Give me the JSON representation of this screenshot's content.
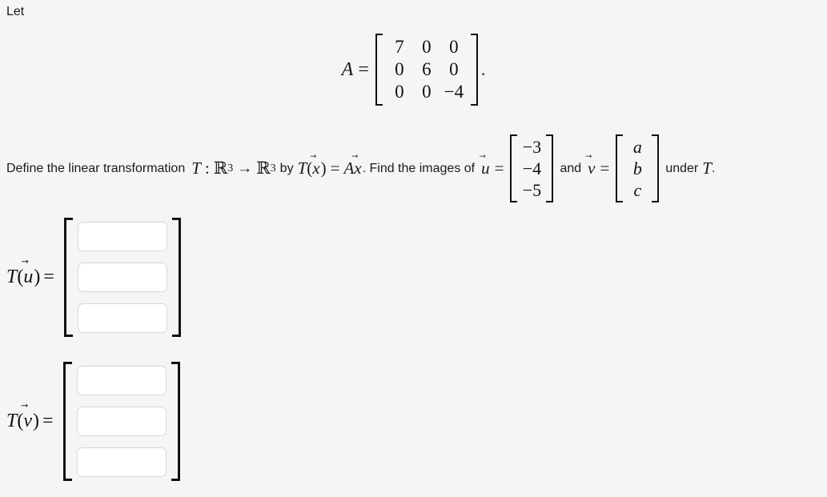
{
  "page": {
    "background_color": "#f5f5f5",
    "text_color": "#1a1a1a"
  },
  "intro": {
    "let_text": "Let"
  },
  "equation_A": {
    "symbol": "A",
    "equals": "=",
    "trailing_punctuation": ".",
    "matrix": {
      "rows": [
        [
          "7",
          "0",
          "0"
        ],
        [
          "0",
          "6",
          "0"
        ],
        [
          "0",
          "0",
          "−4"
        ]
      ]
    }
  },
  "prose": {
    "part1": "Define the linear transformation",
    "T": "T",
    "colon": ":",
    "R": "ℝ",
    "exp_domain": "3",
    "arrow": "→",
    "exp_codomain": "3",
    "by_word": "by",
    "T2": "T",
    "paren_open": "(",
    "x_symbol": "x",
    "paren_close": ")",
    "equals": "=",
    "A_symbol": "A",
    "x_symbol2": "x",
    "part2": ". Find the images of",
    "u_symbol": "u",
    "equals2": "=",
    "and_word": "and",
    "v_symbol": "v",
    "equals3": "=",
    "under_word": "under",
    "T3": "T",
    "final_period": ".",
    "vector_arrow": "⃗"
  },
  "vector_u": {
    "entries": [
      "−3",
      "−4",
      "−5"
    ]
  },
  "vector_v": {
    "entries": [
      "a",
      "b",
      "c"
    ]
  },
  "answer_u": {
    "label_T": "T",
    "label_open": "(",
    "label_symbol": "u",
    "label_close": ")",
    "label_equals": "=",
    "inputs": [
      {
        "value": "",
        "placeholder": ""
      },
      {
        "value": "",
        "placeholder": ""
      },
      {
        "value": "",
        "placeholder": ""
      }
    ]
  },
  "answer_v": {
    "label_T": "T",
    "label_open": "(",
    "label_symbol": "v",
    "label_close": ")",
    "label_equals": "=",
    "inputs": [
      {
        "value": "",
        "placeholder": ""
      },
      {
        "value": "",
        "placeholder": ""
      },
      {
        "value": "",
        "placeholder": ""
      }
    ]
  }
}
